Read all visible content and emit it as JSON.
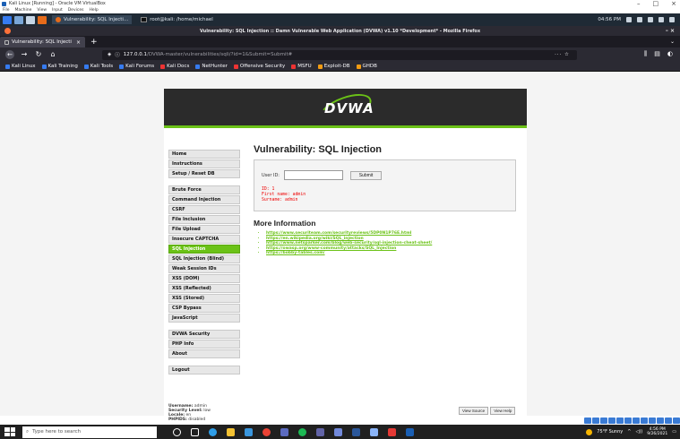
{
  "vbox": {
    "title": "Kali Linux [Running] - Oracle VM VirtualBox",
    "menu": [
      "File",
      "Machine",
      "View",
      "Input",
      "Devices",
      "Help"
    ],
    "controls": [
      "–",
      "□",
      "×"
    ]
  },
  "kali_panel": {
    "task_active": "Vulnerability: SQL Injecti...",
    "task_terminal": "root@kali: /home/michael",
    "time": "04:56 PM"
  },
  "firefox": {
    "window_title": "Vulnerability: SQL Injection :: Damn Vulnerable Web Application (DVWA) v1.10 *Development* - Mozilla Firefox",
    "tab_label": "Vulnerability: SQL Injecti",
    "url_host": "127.0.0.1",
    "url_path": "/DVWA-master/vulnerabilities/sqli/?id=1&Submit=Submit#",
    "url_right": "··· ☆",
    "bookmarks": [
      {
        "label": "Kali Linux",
        "color": "#367bf0"
      },
      {
        "label": "Kali Training",
        "color": "#367bf0"
      },
      {
        "label": "Kali Tools",
        "color": "#367bf0"
      },
      {
        "label": "Kali Forums",
        "color": "#367bf0"
      },
      {
        "label": "Kali Docs",
        "color": "#e33"
      },
      {
        "label": "NetHunter",
        "color": "#367bf0"
      },
      {
        "label": "Offensive Security",
        "color": "#e33"
      },
      {
        "label": "MSFU",
        "color": "#e33"
      },
      {
        "label": "Exploit-DB",
        "color": "#f39c12"
      },
      {
        "label": "GHDB",
        "color": "#f39c12"
      }
    ]
  },
  "dvwa": {
    "logo_text": "DVWA",
    "menu_groups": [
      [
        "Home",
        "Instructions",
        "Setup / Reset DB"
      ],
      [
        "Brute Force",
        "Command Injection",
        "CSRF",
        "File Inclusion",
        "File Upload",
        "Insecure CAPTCHA",
        "SQL Injection",
        "SQL Injection (Blind)",
        "Weak Session IDs",
        "XSS (DOM)",
        "XSS (Reflected)",
        "XSS (Stored)",
        "CSP Bypass",
        "JavaScript"
      ],
      [
        "DVWA Security",
        "PHP Info",
        "About"
      ],
      [
        "Logout"
      ]
    ],
    "active_item": "SQL Injection",
    "page_title": "Vulnerability: SQL Injection",
    "form": {
      "userid_label": "User ID:",
      "userid_value": "",
      "submit_label": "Submit"
    },
    "output": "ID: 1\nFirst name: admin\nSurname: admin",
    "more_info_title": "More Information",
    "links": [
      "https://www.securiteam.com/securityreviews/5DP0N1P76E.html",
      "https://en.wikipedia.org/wiki/SQL_injection",
      "https://www.netsparker.com/blog/web-security/sql-injection-cheat-sheet/",
      "https://owasp.org/www-community/attacks/SQL_Injection",
      "https://bobby-tables.com/"
    ],
    "footer": {
      "username_label": "Username:",
      "username": "admin",
      "security_label": "Security Level:",
      "security": "low",
      "locale_label": "Locale:",
      "locale": "en",
      "phpids_label": "PHPIDS:",
      "phpids": "disabled"
    },
    "view_source": "View Source",
    "view_help": "View Help"
  },
  "windows": {
    "search_placeholder": "Type here to search",
    "weather": "75°F Sunny",
    "time": "4:56 PM",
    "date": "9/26/2021"
  }
}
